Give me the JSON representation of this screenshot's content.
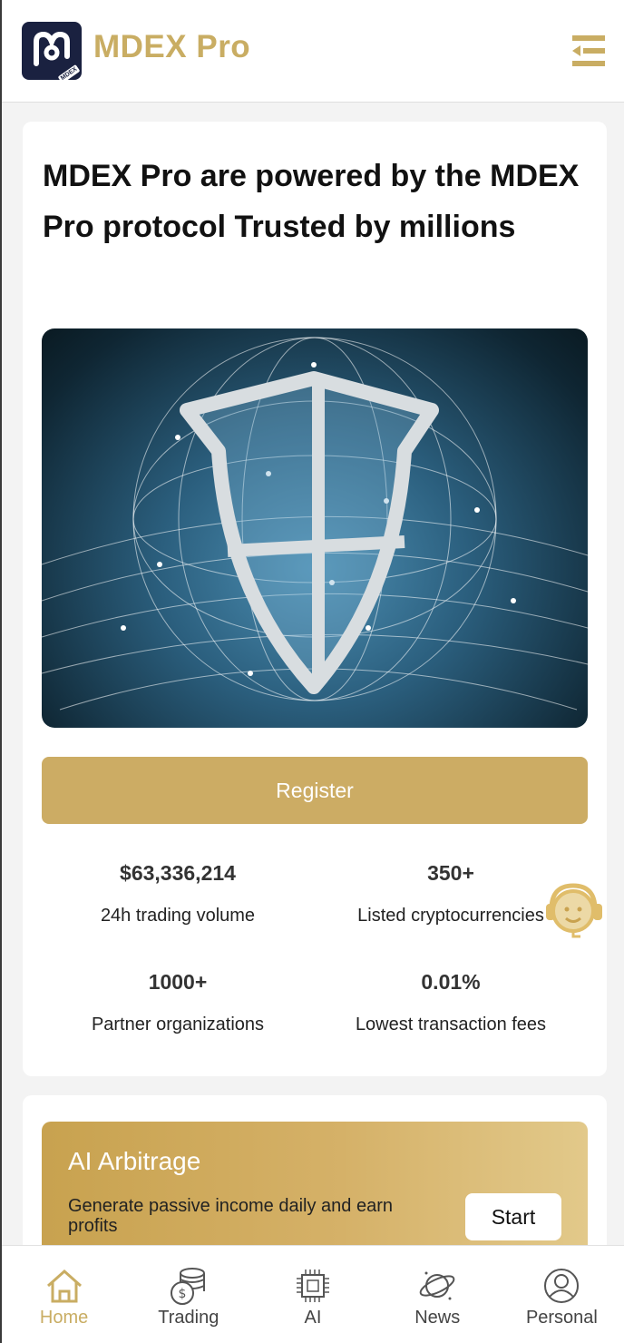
{
  "header": {
    "app_title": "MDEX Pro",
    "logo_tag": "MDEX",
    "menu_icon": "menu-collapse-icon"
  },
  "hero": {
    "headline": "MDEX Pro are powered by the MDEX Pro protocol Trusted by millions",
    "banner_icon": "shield-network-illustration",
    "carousel": {
      "count": 4,
      "active_index": 2
    },
    "register_label": "Register"
  },
  "stats": [
    {
      "value": "$63,336,214",
      "label": "24h trading volume"
    },
    {
      "value": "350+",
      "label": "Listed cryptocurrencies"
    },
    {
      "value": "1000+",
      "label": "Partner organizations"
    },
    {
      "value": "0.01%",
      "label": "Lowest transaction fees"
    }
  ],
  "support_icon": "customer-support-icon",
  "ai_arbitrage": {
    "title": "AI Arbitrage",
    "subtitle": "Generate passive income daily and earn profits",
    "start_label": "Start"
  },
  "bottom_nav": [
    {
      "label": "Home",
      "icon": "home-icon",
      "active": true
    },
    {
      "label": "Trading",
      "icon": "coins-icon",
      "active": false
    },
    {
      "label": "AI",
      "icon": "chip-icon",
      "active": false
    },
    {
      "label": "News",
      "icon": "planet-icon",
      "active": false
    },
    {
      "label": "Personal",
      "icon": "user-icon",
      "active": false
    }
  ],
  "colors": {
    "brand_gold": "#c9ad63",
    "button_gold": "#ccac64",
    "logo_navy": "#1a2140"
  }
}
